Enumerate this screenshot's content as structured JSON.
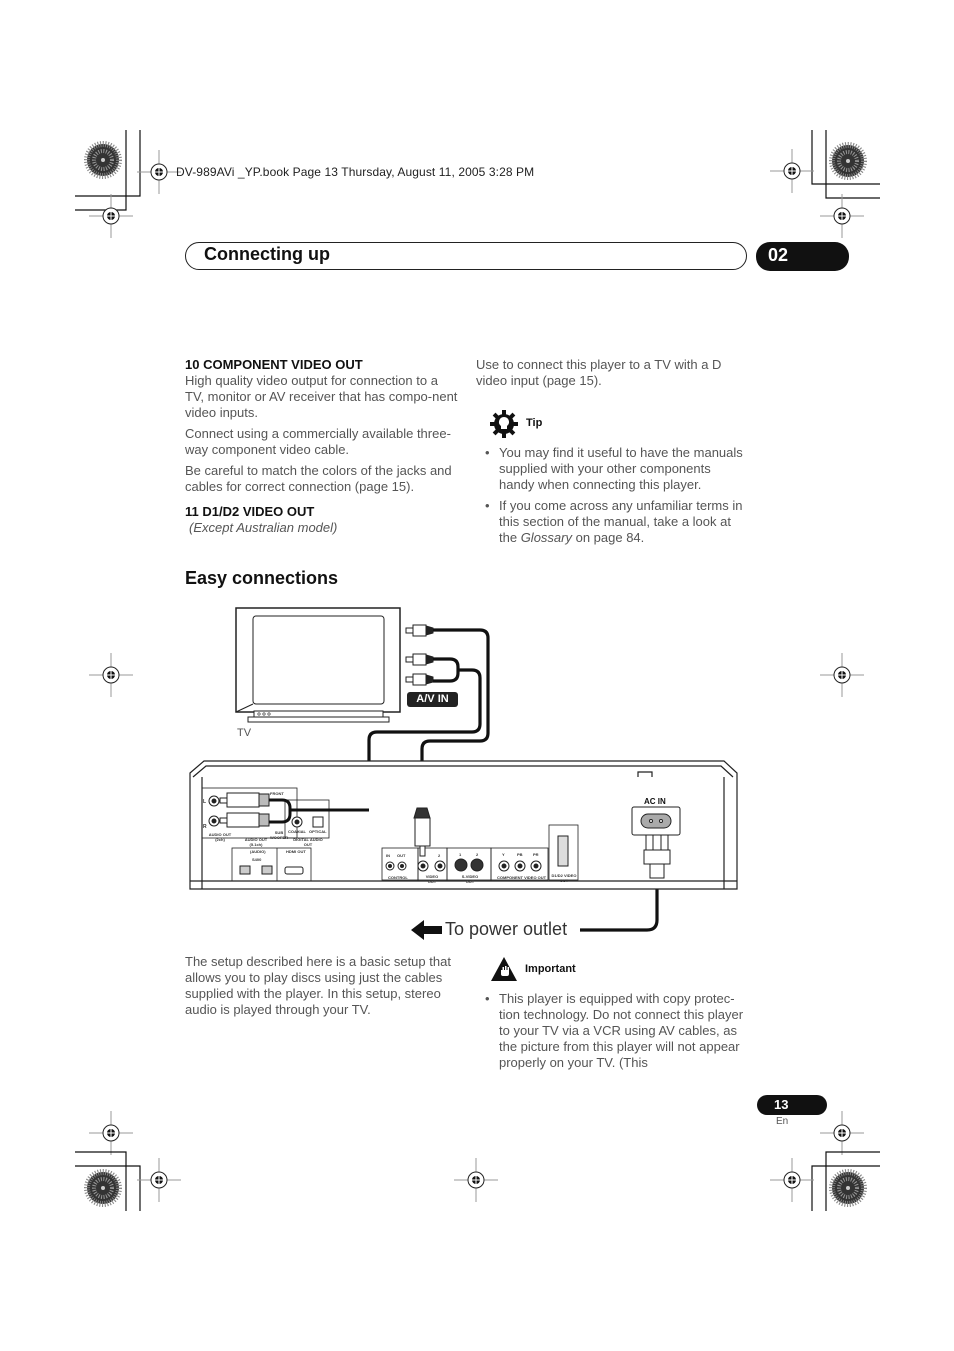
{
  "slug": "DV-989AVi _YP.book  Page 13  Thursday, August 11, 2005  3:28 PM",
  "header": {
    "title": "Connecting up",
    "chapter": "02"
  },
  "left_column": {
    "item10_heading": "10  COMPONENT VIDEO OUT",
    "item10_paragraphs": [
      "High quality video output for connection to a TV, monitor or AV receiver that has compo-nent video inputs.",
      "Connect using a commercially available three-way component video cable.",
      "Be careful to match the colors of the jacks and cables for correct connection (page 15)."
    ],
    "item11_heading": "11  D1/D2 VIDEO OUT",
    "item11_note": "(Except Australian model)"
  },
  "right_column": {
    "d_video_text": "Use to connect this player to a TV with a D video input (page 15).",
    "tip": {
      "icon": "lightbulb-gear-icon",
      "label": "Tip",
      "bullets": [
        {
          "text": "You may find it useful to have the manuals supplied with your other components handy when connecting this player."
        },
        {
          "pre": "If you come across any unfamiliar terms in this section of the manual, take a look at the ",
          "em": "Glossary",
          "post": " on page 84."
        }
      ]
    }
  },
  "section": {
    "title": "Easy connections"
  },
  "diagram": {
    "tv_label": "TV",
    "av_in_label": "A/V IN",
    "ac_in_label": "AC  IN",
    "power_outlet_label": "To power outlet",
    "arrow_icon": "arrow-left-icon",
    "player_labels": {
      "l": "L",
      "r": "R",
      "audio_out_2ch": "AUDIO OUT (2ch)",
      "audio_out_51ch": "AUDIO OUT (5.1ch)",
      "front": "FRONT",
      "sub_woofer": "SUB WOOFER",
      "coaxial": "COAXIAL",
      "optical": "OPTICAL",
      "digital_audio_out": "DIGITAL AUDIO OUT",
      "i_link_audio": "(AUDIO)",
      "s400": "S400",
      "hdmi_out": "HDMI OUT",
      "control_in": "IN",
      "control_out": "OUT",
      "control": "CONTROL",
      "video_out_2": "2",
      "video_out": "VIDEO OUT",
      "s_video_1": "1",
      "s_video_2": "2",
      "s_video_out": "S-VIDEO OUT",
      "y": "Y",
      "pb": "PB",
      "pr": "PR",
      "component_video_out": "COMPONENT VIDEO OUT",
      "d1d2_video_out": "D1/D2 VIDEO OUT"
    }
  },
  "bottom_left": {
    "text": "The setup described here is a basic setup that allows you to play discs using just the cables supplied with the player. In this setup, stereo audio is played through your TV."
  },
  "bottom_right": {
    "important": {
      "icon": "warning-hand-icon",
      "label": "Important",
      "bullets": [
        "This player is equipped with copy protec-tion technology. Do not connect this player to your TV via a VCR using AV cables, as the picture from this player will not appear properly on your TV. (This"
      ]
    }
  },
  "footer": {
    "page_number": "13",
    "language": "En"
  }
}
